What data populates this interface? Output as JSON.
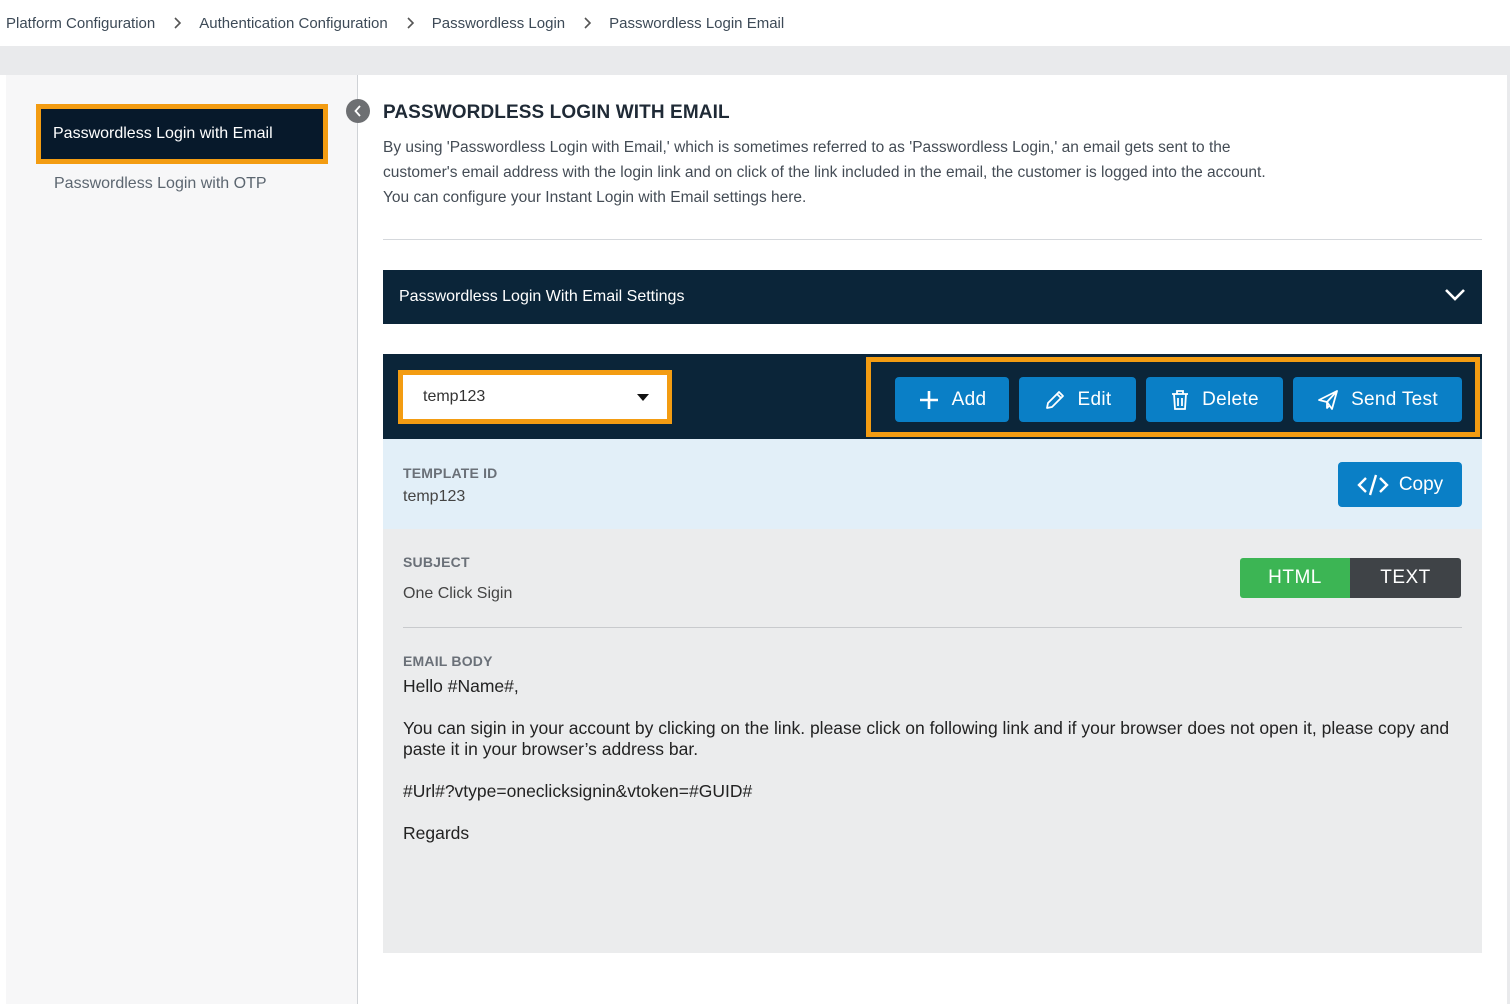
{
  "breadcrumb": {
    "items": [
      "Platform Configuration",
      "Authentication Configuration",
      "Passwordless Login",
      "Passwordless Login Email"
    ]
  },
  "sidebar": {
    "items": [
      {
        "label": "Passwordless Login with Email",
        "active": true
      },
      {
        "label": "Passwordless Login with OTP",
        "active": false
      }
    ]
  },
  "main": {
    "title": "PASSWORDLESS LOGIN WITH EMAIL",
    "description": "By using 'Passwordless Login with Email,' which is sometimes referred to as 'Passwordless Login,' an email gets sent to the customer's email address with the login link and on click of the link included in the email, the customer is logged into the account. You can configure your Instant Login with Email settings here.",
    "accordion_title": "Passwordless Login With Email Settings"
  },
  "toolbar": {
    "selected_template": "temp123",
    "add_label": "Add",
    "edit_label": "Edit",
    "delete_label": "Delete",
    "send_test_label": "Send Test"
  },
  "template": {
    "id_label": "TEMPLATE ID",
    "id_value": "temp123",
    "copy_label": "Copy"
  },
  "email": {
    "subject_label": "SUBJECT",
    "subject_value": "One Click Sigin",
    "format_html_label": "HTML",
    "format_text_label": "TEXT",
    "body_label": "EMAIL BODY",
    "body_lines": [
      "Hello #Name#,",
      "You can sigin in your account by clicking on the link. please click on following link and if your browser does not open it, please copy and paste it in your browser’s address bar.",
      "#Url#?vtype=oneclicksignin&vtoken=#GUID#",
      "Regards"
    ]
  },
  "colors": {
    "highlight": "#f39c12",
    "navy": "#0b2539",
    "primary_button": "#0a7fc6",
    "html_toggle": "#3cb554",
    "text_toggle": "#3f4347"
  }
}
